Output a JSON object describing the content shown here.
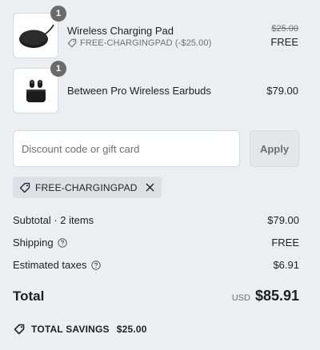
{
  "line_items": [
    {
      "name": "Wireless Charging Pad",
      "quantity": "1",
      "discount_label": "FREE-CHARGINGPAD (-$25.00)",
      "compare_at_price": "$25.00",
      "price": "FREE",
      "thumbnail_icon": "charging-pad-image"
    },
    {
      "name": "Between Pro Wireless Earbuds",
      "quantity": "1",
      "price": "$79.00",
      "thumbnail_icon": "earbuds-image"
    }
  ],
  "discount": {
    "placeholder": "Discount code or gift card",
    "value": "",
    "apply_label": "Apply",
    "applied_code": "FREE-CHARGINGPAD"
  },
  "summary": {
    "subtotal_label": "Subtotal · 2 items",
    "subtotal_value": "$79.00",
    "shipping_label": "Shipping",
    "shipping_value": "FREE",
    "taxes_label": "Estimated taxes",
    "taxes_value": "$6.91",
    "total_label": "Total",
    "currency": "USD",
    "total_value": "$85.91",
    "savings_label": "TOTAL SAVINGS",
    "savings_value": "$25.00"
  },
  "colors": {
    "background": "#eceff1",
    "badge": "#6b6b6b",
    "muted_text": "#707070",
    "apply_button": "#e4e7ea"
  }
}
